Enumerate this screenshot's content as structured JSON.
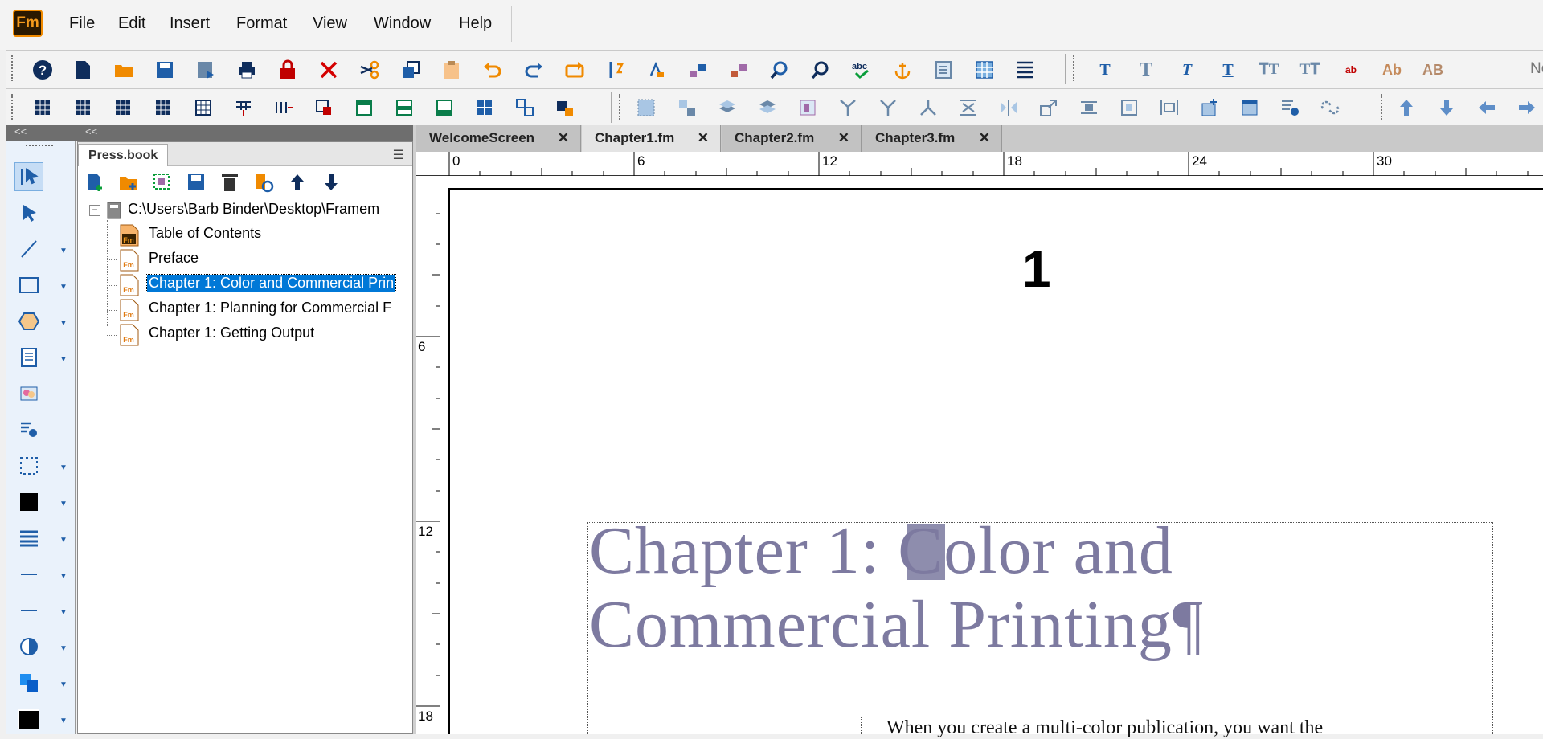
{
  "app": {
    "logo_text": "Fm"
  },
  "menu": [
    "File",
    "Edit",
    "Insert",
    "Format",
    "View",
    "Window",
    "Help"
  ],
  "toolbar_overflow_text": "No",
  "panel_header": {
    "left_chevrons": "<<",
    "right_chevrons": "<<"
  },
  "book_panel": {
    "tab_label": "Press.book",
    "root_path": "C:\\Users\\Barb Binder\\Desktop\\Framem",
    "items": [
      {
        "label": "Table of Contents",
        "selected": false
      },
      {
        "label": "Preface",
        "selected": false
      },
      {
        "label": "Chapter 1: Color and Commercial Prin",
        "selected": true
      },
      {
        "label": "Chapter 1: Planning for Commercial F",
        "selected": false
      },
      {
        "label": "Chapter 1: Getting Output",
        "selected": false
      }
    ]
  },
  "doc_tabs": [
    {
      "label": "WelcomeScreen",
      "active": false
    },
    {
      "label": "Chapter1.fm",
      "active": true
    },
    {
      "label": "Chapter2.fm",
      "active": false
    },
    {
      "label": "Chapter3.fm",
      "active": false
    }
  ],
  "ruler": {
    "horizontal": [
      "0",
      "6",
      "12",
      "18",
      "24",
      "30"
    ],
    "vertical": [
      "6",
      "12",
      "18"
    ]
  },
  "document": {
    "page_number": "1",
    "title_line1": "Chapter 1: Color and",
    "title_line2": "Commercial Printing",
    "pilcrow": "¶",
    "body_start": "When you create a multi-color publication, you want the"
  },
  "colors": {
    "title_color": "#7d7aa0",
    "selection": "#0078d7",
    "tool_icon_blue": "#1f5ea8",
    "logo_orange": "#f08a00"
  }
}
